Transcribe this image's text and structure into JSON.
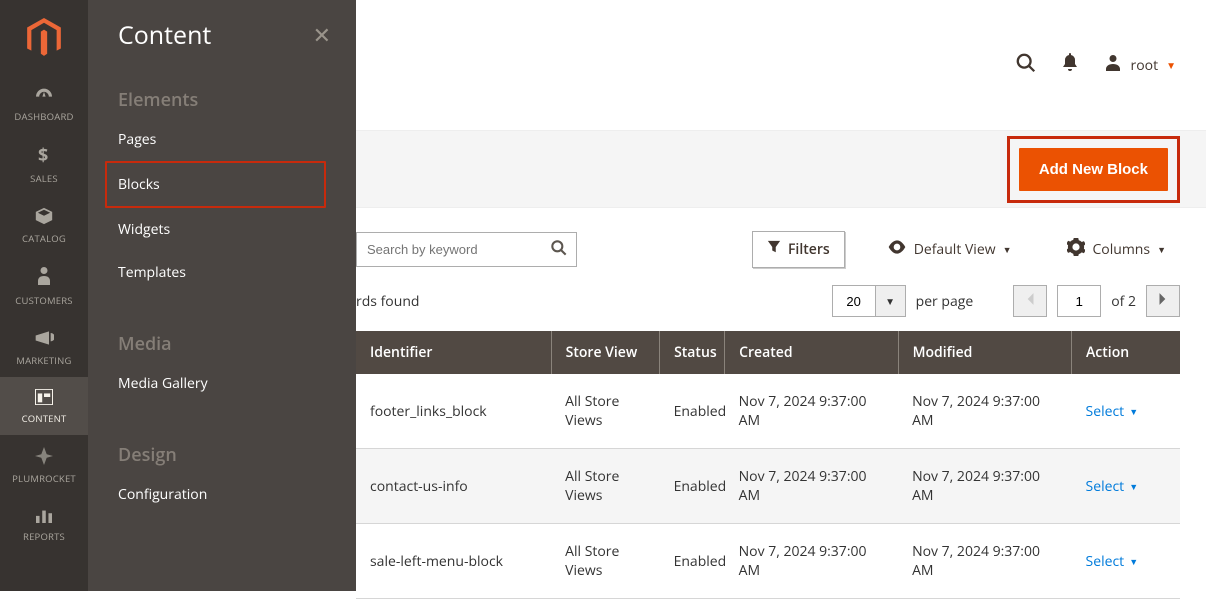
{
  "sidebar": {
    "items": [
      {
        "label": "DASHBOARD"
      },
      {
        "label": "SALES"
      },
      {
        "label": "CATALOG"
      },
      {
        "label": "CUSTOMERS"
      },
      {
        "label": "MARKETING"
      },
      {
        "label": "CONTENT"
      },
      {
        "label": "PLUMROCKET"
      },
      {
        "label": "REPORTS"
      }
    ]
  },
  "submenu": {
    "title": "Content",
    "sections": [
      {
        "title": "Elements",
        "links": [
          "Pages",
          "Blocks",
          "Widgets",
          "Templates"
        ]
      },
      {
        "title": "Media",
        "links": [
          "Media Gallery"
        ]
      },
      {
        "title": "Design",
        "links": [
          "Configuration"
        ]
      }
    ]
  },
  "user": {
    "name": "root"
  },
  "action_button": "Add New Block",
  "search": {
    "placeholder": "Search by keyword"
  },
  "toolbar": {
    "filters": "Filters",
    "default_view": "Default View",
    "columns": "Columns"
  },
  "records_found": "rds found",
  "pager": {
    "per_page_value": "20",
    "per_page_label": "per page",
    "page_value": "1",
    "of_label": "of 2"
  },
  "grid": {
    "headers": [
      "Identifier",
      "Store View",
      "Status",
      "Created",
      "Modified",
      "Action"
    ],
    "rows": [
      {
        "identifier": "footer_links_block",
        "store": "All Store Views",
        "status": "Enabled",
        "created": "Nov 7, 2024 9:37:00 AM",
        "modified": "Nov 7, 2024 9:37:00 AM",
        "action": "Select"
      },
      {
        "identifier": "contact-us-info",
        "store": "All Store Views",
        "status": "Enabled",
        "created": "Nov 7, 2024 9:37:00 AM",
        "modified": "Nov 7, 2024 9:37:00 AM",
        "action": "Select"
      },
      {
        "identifier": "sale-left-menu-block",
        "store": "All Store Views",
        "status": "Enabled",
        "created": "Nov 7, 2024 9:37:00 AM",
        "modified": "Nov 7, 2024 9:37:00 AM",
        "action": "Select"
      }
    ]
  }
}
